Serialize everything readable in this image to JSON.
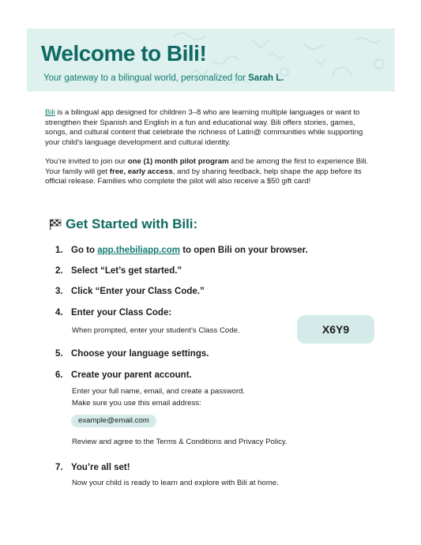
{
  "header": {
    "title": "Welcome to Bili!",
    "subtitle_prefix": "Your gateway to a bilingual world, personalized for ",
    "parent_name": "Sarah L."
  },
  "intro": {
    "p1_link": "Bili",
    "p1_text": " is a bilingual app designed for children 3–8 who are learning multiple languages or want to strengthen their Spanish and English in a fun and educational way. Bili offers stories, games, songs, and cultural content that celebrate the richness of Latin@ communities while supporting your child’s language development and cultural identity.",
    "p2_a": "You’re invited to join our ",
    "p2_b": "one (1) month pilot program",
    "p2_c": " and be among the first to experience Bili. Your family will get ",
    "p2_d": "free, early access",
    "p2_e": ", and by sharing feedback, help shape the app before its official release. Families who complete the pilot will also receive a $50 gift card!"
  },
  "section": {
    "title": "Get Started with Bili:",
    "icon": "checkered-flag-icon"
  },
  "steps": [
    {
      "num": "1.",
      "pre": "Go to ",
      "link": "app.thebiliapp.com",
      "post": " to open Bili on your browser."
    },
    {
      "num": "2.",
      "text": "Select “Let’s get started.”"
    },
    {
      "num": "3.",
      "text": "Click “Enter your Class Code.”"
    },
    {
      "num": "4.",
      "text": "Enter your Class Code:",
      "sub": "When prompted, enter your student’s Class Code.",
      "code": "X6Y9"
    },
    {
      "num": "5.",
      "text": "Choose your language settings."
    },
    {
      "num": "6.",
      "text": "Create your parent account.",
      "sub1": "Enter your full name, email, and create a password.",
      "sub2": "Make sure you use this email address:",
      "email": "example@email.com",
      "sub3": "Review and agree to the Terms & Conditions and Privacy Policy."
    },
    {
      "num": "7.",
      "text": "You’re all set!",
      "sub": "Now your child is ready to learn and explore with Bili at home."
    }
  ],
  "colors": {
    "brand_teal": "#0f6a63",
    "banner_bg": "#dff1ef",
    "pill_bg": "#d4ebe9"
  }
}
